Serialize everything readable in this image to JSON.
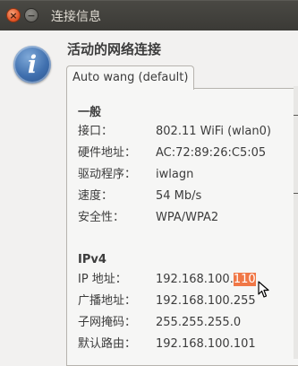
{
  "window": {
    "title": "连接信息",
    "close_glyph": "×",
    "minimize_glyph": "−"
  },
  "header": {
    "icon": "info-icon",
    "icon_glyph": "i",
    "title": "活动的网络连接"
  },
  "tabs": [
    {
      "label": "Auto wang (default)",
      "active": true
    }
  ],
  "general": {
    "heading": "一般",
    "rows": [
      {
        "label": "接口：",
        "value": "802.11 WiFi (wlan0)"
      },
      {
        "label": "硬件地址：",
        "value": "AC:72:89:26:C5:05"
      },
      {
        "label": "驱动程序：",
        "value": "iwlagn"
      },
      {
        "label": "速度：",
        "value": "54 Mb/s"
      },
      {
        "label": "安全性：",
        "value": "WPA/WPA2"
      }
    ]
  },
  "ipv4": {
    "heading": "IPv4",
    "ip_label": "IP 地址：",
    "ip_prefix": "192.168.100.",
    "ip_selected": "110",
    "rows": [
      {
        "label": "广播地址：",
        "value": "192.168.100.255"
      },
      {
        "label": "子网掩码：",
        "value": "255.255.255.0"
      },
      {
        "label": "默认路由：",
        "value": "192.168.100.101"
      }
    ]
  },
  "colors": {
    "titlebar": "#3e3d39",
    "selection": "#f07746",
    "accent_icon": "#3f6fae"
  }
}
